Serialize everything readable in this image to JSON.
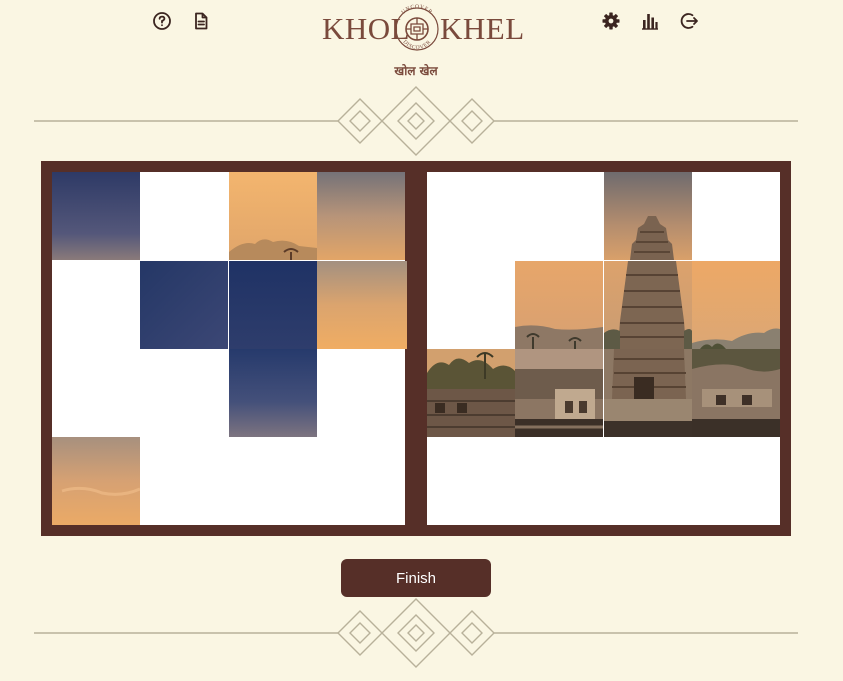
{
  "header": {
    "logo_left_word": "KHOL",
    "logo_right_word": "KHEL",
    "logo_arc_top": "UNCOVER",
    "logo_arc_bottom": "DISCOVER",
    "logo_subtitle": "खोल खेल",
    "icons_left": [
      "help-icon",
      "document-icon"
    ],
    "icons_right": [
      "settings-icon",
      "stats-icon",
      "logout-icon"
    ]
  },
  "colors": {
    "background": "#faf6e3",
    "board_frame": "#562f28",
    "button": "#562f28",
    "button_text": "#ffffff",
    "ornament": "#b8b19a"
  },
  "puzzle": {
    "grid_size": "4x4",
    "pool_tiles": [
      {
        "row": 0,
        "col": 0,
        "content": "dusk-sky-blue"
      },
      {
        "row": 0,
        "col": 2,
        "content": "orange-sky-palm-hills"
      },
      {
        "row": 0,
        "col": 3,
        "content": "grey-orange-sky"
      },
      {
        "row": 1,
        "col": 1,
        "content": "deep-blue-sky"
      },
      {
        "row": 1,
        "col": 2,
        "content": "deep-blue-sky"
      },
      {
        "row": 1,
        "col": 3,
        "content": "orange-sky"
      },
      {
        "row": 2,
        "col": 2,
        "content": "blue-sky-gradient"
      },
      {
        "row": 3,
        "col": 0,
        "content": "orange-sky-clouds"
      }
    ],
    "placed_tiles": [
      {
        "row": 0,
        "col": 2,
        "content": "temple-gopuram-top"
      },
      {
        "row": 1,
        "col": 1,
        "content": "orange-sky-hills"
      },
      {
        "row": 1,
        "col": 2,
        "content": "temple-gopuram-middle"
      },
      {
        "row": 1,
        "col": 3,
        "content": "orange-sky-hills-right"
      },
      {
        "row": 2,
        "col": 0,
        "content": "ruins-left"
      },
      {
        "row": 2,
        "col": 1,
        "content": "ruins-center-left"
      },
      {
        "row": 2,
        "col": 2,
        "content": "temple-base"
      },
      {
        "row": 2,
        "col": 3,
        "content": "ruins-right"
      }
    ]
  },
  "actions": {
    "finish_label": "Finish"
  }
}
